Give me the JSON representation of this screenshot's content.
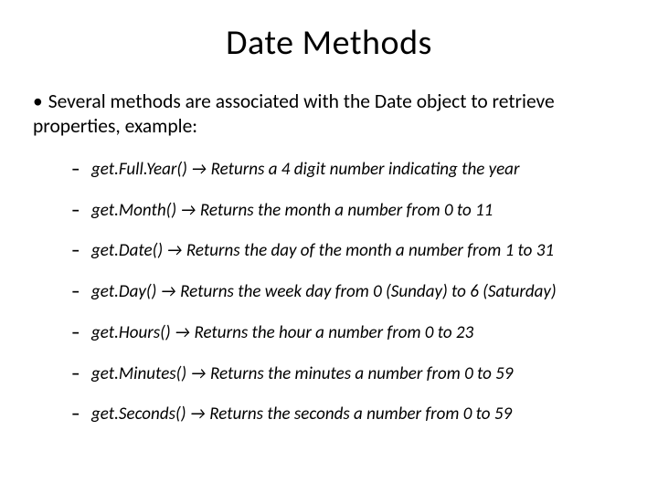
{
  "title": "Date Methods",
  "lead": "Several methods are associated with the Date object to retrieve properties, example:",
  "methods": [
    "get.Full.Year() → Returns a 4 digit number indicating the year",
    "get.Month() → Returns the month a number from 0 to 11",
    "get.Date() → Returns the day of the month a number from 1 to 31",
    "get.Day() → Returns the week day from 0 (Sunday) to 6 (Saturday)",
    "get.Hours() → Returns the hour a number from 0 to 23",
    "get.Minutes() → Returns the minutes a number from 0 to 59",
    "get.Seconds() → Returns the seconds a number from 0 to 59"
  ]
}
